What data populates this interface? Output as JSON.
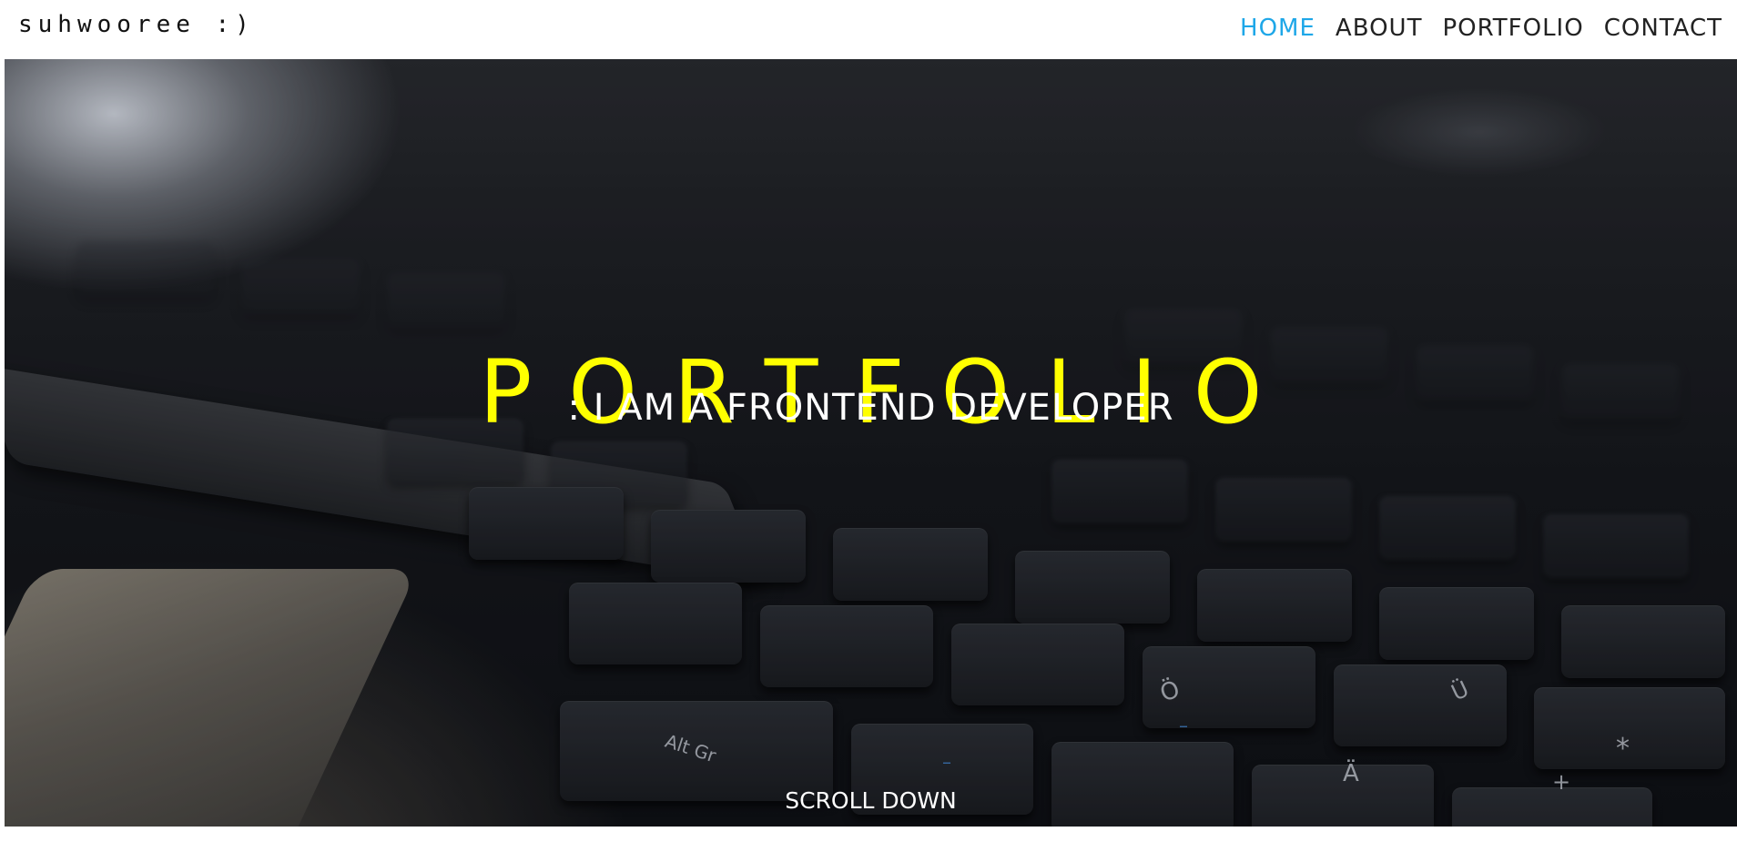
{
  "header": {
    "logo": "suhwooree :)",
    "nav": [
      {
        "label": "HOME",
        "active": true
      },
      {
        "label": "ABOUT",
        "active": false
      },
      {
        "label": "PORTFOLIO",
        "active": false
      },
      {
        "label": "CONTACT",
        "active": false
      }
    ]
  },
  "hero": {
    "title": "PORTFOLIO",
    "subtitle": ": I AM A FRONTEND DEVELOPER",
    "scroll_label": "SCROLL DOWN",
    "background_image": "laptop-keyboard-photo"
  },
  "colors": {
    "accent_nav": "#1ea7e8",
    "title": "#ffff00",
    "subtitle": "#ffffff",
    "background": "#ffffff"
  }
}
